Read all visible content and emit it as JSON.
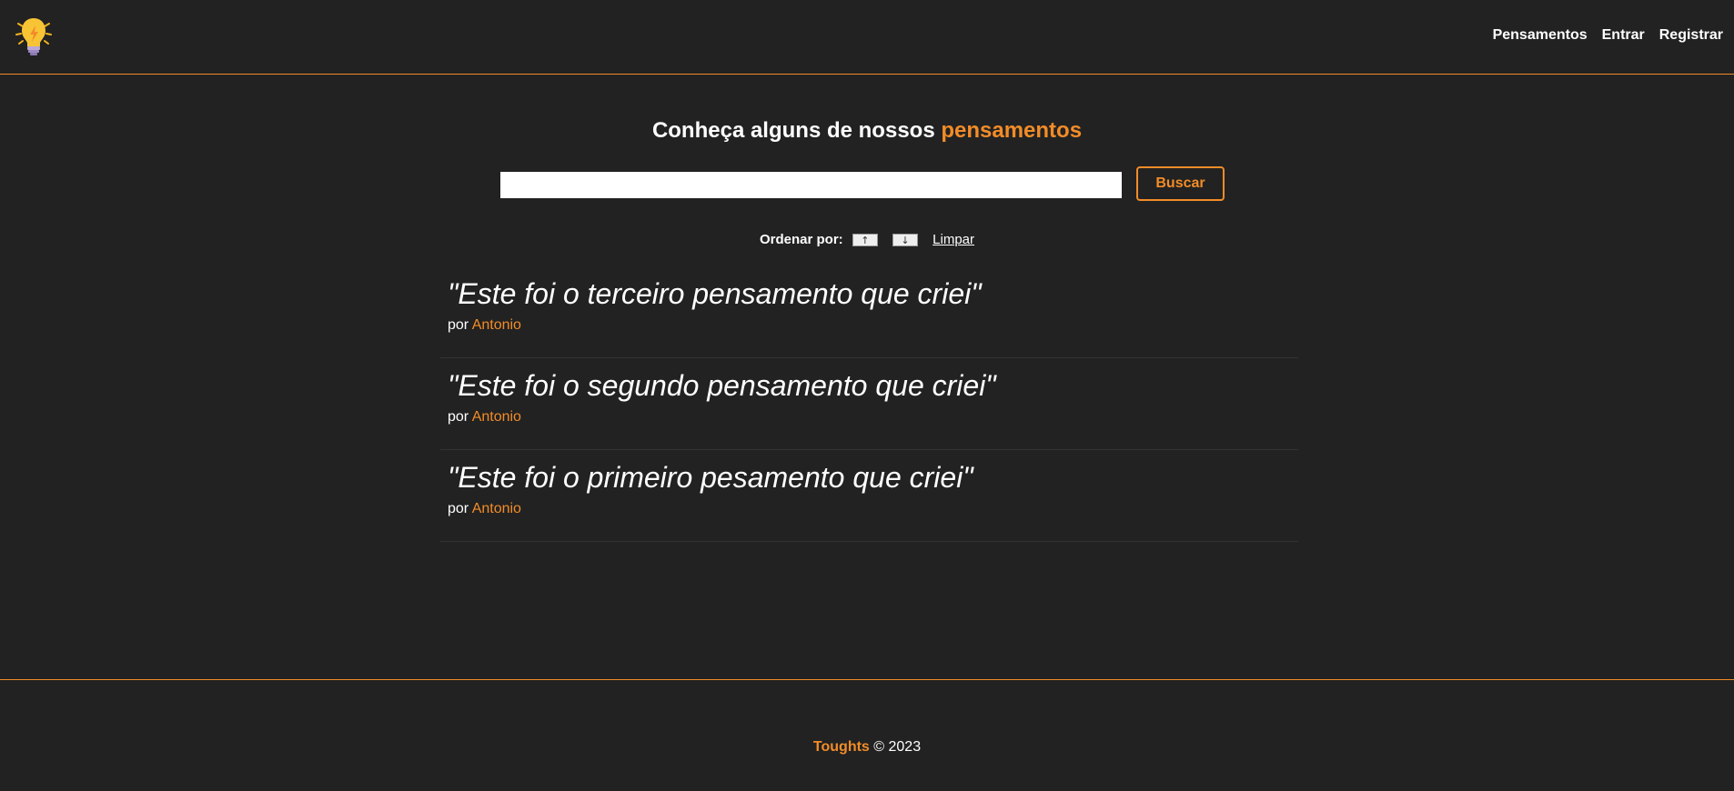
{
  "header": {
    "logo_icon": "lightbulb-icon",
    "nav": {
      "thoughts_label": "Pensamentos",
      "login_label": "Entrar",
      "register_label": "Registrar"
    }
  },
  "main": {
    "title_prefix": "Conheça alguns de nossos",
    "title_accent": "pensamentos",
    "search": {
      "value": "",
      "placeholder": "",
      "button_label": "Buscar"
    },
    "order": {
      "label": "Ordenar por:",
      "asc_icon": "arrow-up-icon",
      "asc_label": "↑",
      "desc_icon": "arrow-down-icon",
      "desc_label": "↓",
      "clear_label": "Limpar"
    },
    "thoughts": [
      {
        "text": "\"Este foi o terceiro pensamento que criei\"",
        "by_label": "por",
        "author": "Antonio"
      },
      {
        "text": "\"Este foi o segundo pensamento que criei\"",
        "by_label": "por",
        "author": "Antonio"
      },
      {
        "text": "\"Este foi o primeiro pesamento que criei\"",
        "by_label": "por",
        "author": "Antonio"
      }
    ]
  },
  "footer": {
    "brand": "Toughts",
    "copyright": "© 2023"
  },
  "colors": {
    "background": "#222222",
    "accent": "#f28c28",
    "text": "#ffffff"
  }
}
